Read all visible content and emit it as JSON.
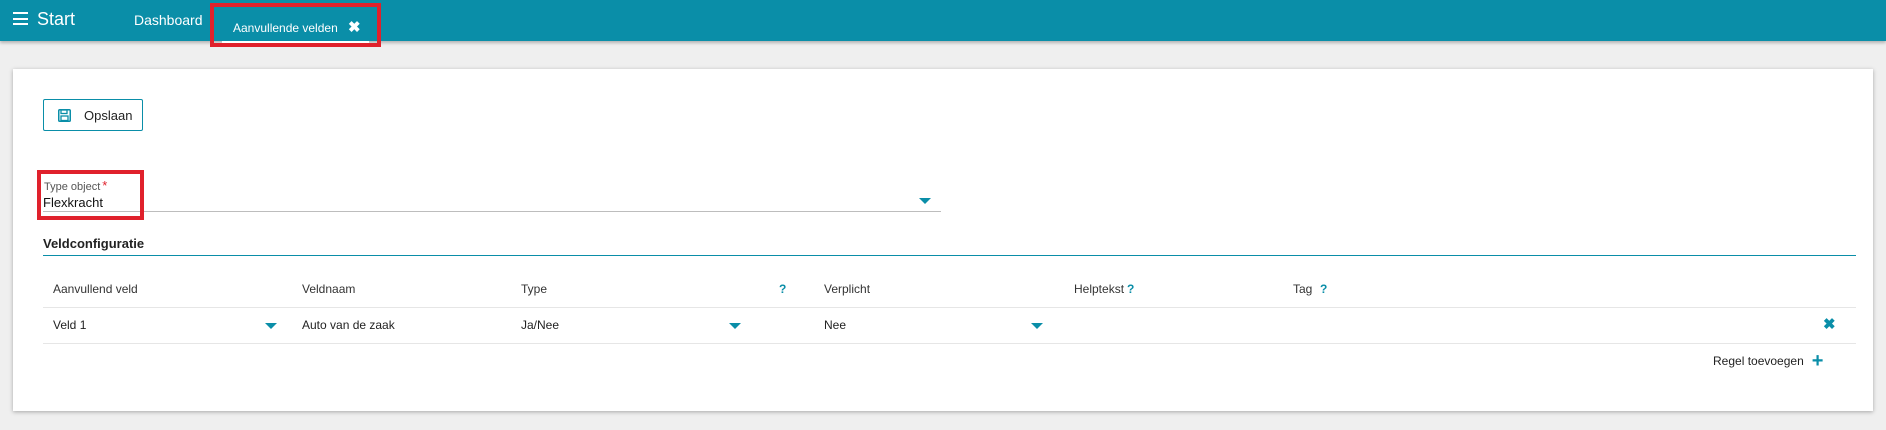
{
  "topbar": {
    "brand": "Start",
    "tabs": [
      {
        "label": "Dashboard"
      },
      {
        "label": "Aanvullende velden",
        "close": "✖"
      }
    ]
  },
  "toolbar": {
    "save_label": "Opslaan"
  },
  "type_object": {
    "label": "Type object",
    "required_mark": "*",
    "value": "Flexkracht"
  },
  "section": {
    "title": "Veldconfiguratie"
  },
  "table": {
    "headers": {
      "aanvullend_veld": "Aanvullend veld",
      "veldnaam": "Veldnaam",
      "type": "Type",
      "type_help": "?",
      "verplicht": "Verplicht",
      "helptekst": "Helptekst",
      "helptekst_help": "?",
      "tag": "Tag",
      "tag_help": "?"
    },
    "rows": [
      {
        "aanvullend_veld": "Veld 1",
        "veldnaam": "Auto van de zaak",
        "type": "Ja/Nee",
        "verplicht": "Nee",
        "helptekst": "",
        "tag": "",
        "delete": "✖"
      }
    ]
  },
  "add_rule": {
    "label": "Regel toevoegen",
    "icon": "+"
  },
  "colors": {
    "primary": "#0a8ea8",
    "highlight": "#e0212c"
  }
}
